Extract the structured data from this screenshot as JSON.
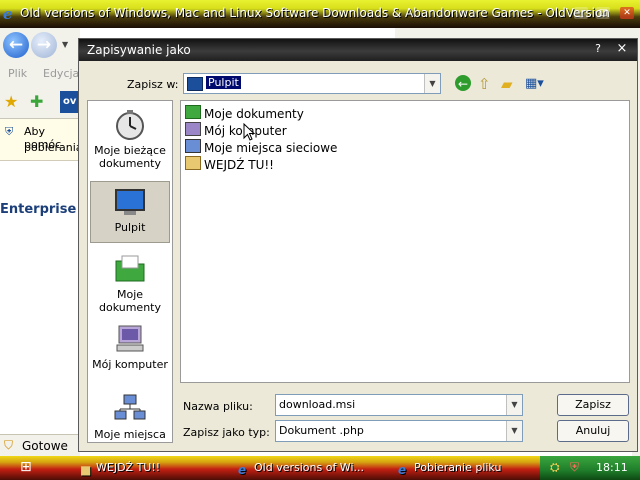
{
  "browser": {
    "title": "Old versions of Windows, Mac and Linux Software Downloads & Abandonware Games - OldVersion",
    "menu_file": "Plik",
    "menu_edit": "Edycja",
    "infobar_line1": "Aby pomóc",
    "infobar_line2": "pobierania",
    "content_heading": "Enterprise",
    "status_text": "Gotowe"
  },
  "dialog": {
    "title": "Zapisywanie jako",
    "help_label": "?",
    "close_label": "×",
    "save_in_label": "Zapisz w:",
    "save_in_value": "Pulpit",
    "places": [
      {
        "label": "Moje bieżące dokumenty"
      },
      {
        "label": "Pulpit"
      },
      {
        "label": "Moje dokumenty"
      },
      {
        "label": "Mój komputer"
      },
      {
        "label": "Moje miejsca"
      }
    ],
    "files": [
      {
        "name": "Moje dokumenty",
        "icon": "my-documents-icon"
      },
      {
        "name": "Mój komputer",
        "icon": "my-computer-icon"
      },
      {
        "name": "Moje miejsca sieciowe",
        "icon": "network-places-icon"
      },
      {
        "name": "WEJDŹ TU!!",
        "icon": "shortcut-icon"
      }
    ],
    "filename_label": "Nazwa pliku:",
    "filename_value": "download.msi",
    "filetype_label": "Zapisz jako typ:",
    "filetype_value": "Dokument .php",
    "save_button": "Zapisz",
    "cancel_button": "Anuluj"
  },
  "taskbar": {
    "items": [
      {
        "label": "WEJDŹ TU!!"
      },
      {
        "label": "Old versions of Wi..."
      },
      {
        "label": "Pobieranie pliku"
      }
    ],
    "clock": "18:11"
  },
  "colors": {
    "dialog_bg": "#ece9d8",
    "title_dark": "#1f1f1f",
    "taskbar_red": "#c21f12",
    "tray_green": "#1f7d2a"
  }
}
